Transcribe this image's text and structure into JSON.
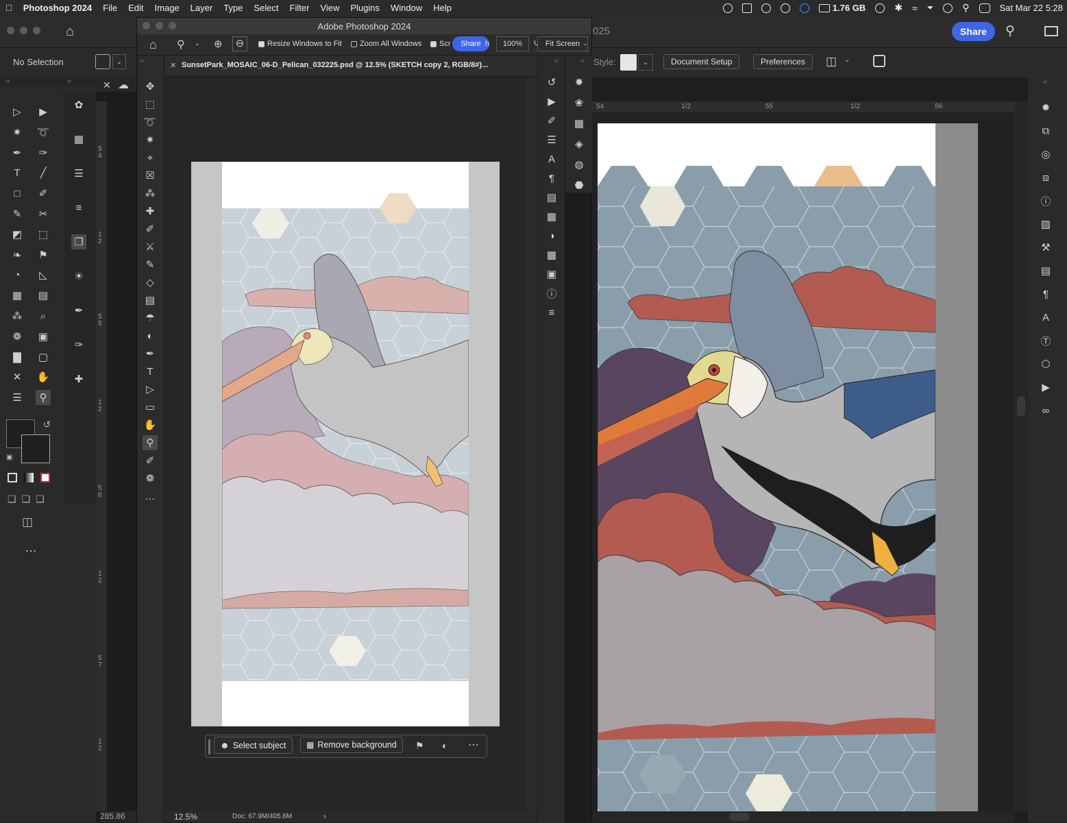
{
  "menubar": {
    "app": "Photoshop 2024",
    "items": [
      "File",
      "Edit",
      "Image",
      "Layer",
      "Type",
      "Select",
      "Filter",
      "View",
      "Plugins",
      "Window",
      "Help"
    ],
    "memory": "1.76 GB",
    "datetime": "Sat Mar 22  5:28"
  },
  "main": {
    "title_suffix": "025",
    "share_label": "Share",
    "options": {
      "selection": "No Selection",
      "style_label": "Style:",
      "document_setup": "Document Setup",
      "preferences": "Preferences"
    },
    "ruler_top": [
      "54",
      "1/2",
      "55",
      "1/2",
      "56"
    ],
    "ruler_left": [
      "5",
      "4",
      "1",
      "2",
      "5",
      "5",
      "1",
      "2",
      "5",
      "6",
      "1",
      "2",
      "5",
      "7",
      "1",
      "2"
    ],
    "status_left": "285.86"
  },
  "float_window": {
    "title": "Adobe Photoshop 2024",
    "share_label": "Share",
    "resize_windows": "Resize Windows to Fit",
    "zoom_all": "Zoom All Windows",
    "scrubby": "Scr",
    "scrubby_tail": "h",
    "zoom_value": "100%",
    "fit_screen": "Fit Screen",
    "doc_tab": "SunsetPark_MOSAIC_06-D_Pelican_032225.psd @ 12.5% (SKETCH copy 2, RGB/8#)...",
    "zoom_status": "12.5%",
    "doc_status": "Doc: 67.9M/405.6M",
    "ctx_select_subject": "Select subject",
    "ctx_remove_background": "Remove background"
  },
  "colors": {
    "hex_blue": "#8a9daa",
    "hex_light": "#c8d0d8",
    "cloud_red": "#b35b50",
    "cloud_purple": "#5a4560",
    "cloud_gray": "#a8a2a6",
    "accent": "#3e66e6"
  }
}
